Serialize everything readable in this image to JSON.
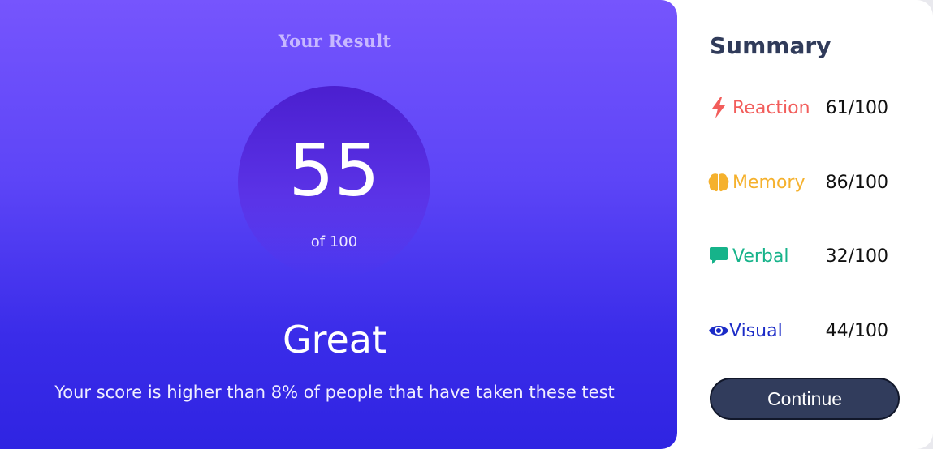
{
  "result": {
    "title": "Your Result",
    "score": "55",
    "score_of": "of 100",
    "rating": "Great",
    "description": "Your score is higher than 8% of people that have taken these test"
  },
  "summary": {
    "title": "Summary",
    "items": [
      {
        "label": "Reaction",
        "value": "61/100",
        "icon": "lightning-icon",
        "color": "#f25d5b"
      },
      {
        "label": "Memory",
        "value": "86/100",
        "icon": "brain-icon",
        "color": "#f5b12d"
      },
      {
        "label": "Verbal",
        "value": "32/100",
        "icon": "chat-bubble-icon",
        "color": "#16b38a"
      },
      {
        "label": "Visual",
        "value": "44/100",
        "icon": "eye-icon",
        "color": "#1b2bc7"
      }
    ],
    "continue_label": "Continue"
  },
  "colors": {
    "gradient_top": "#7655fd",
    "gradient_bottom": "#2f24e2",
    "button_bg": "#313c5c"
  }
}
